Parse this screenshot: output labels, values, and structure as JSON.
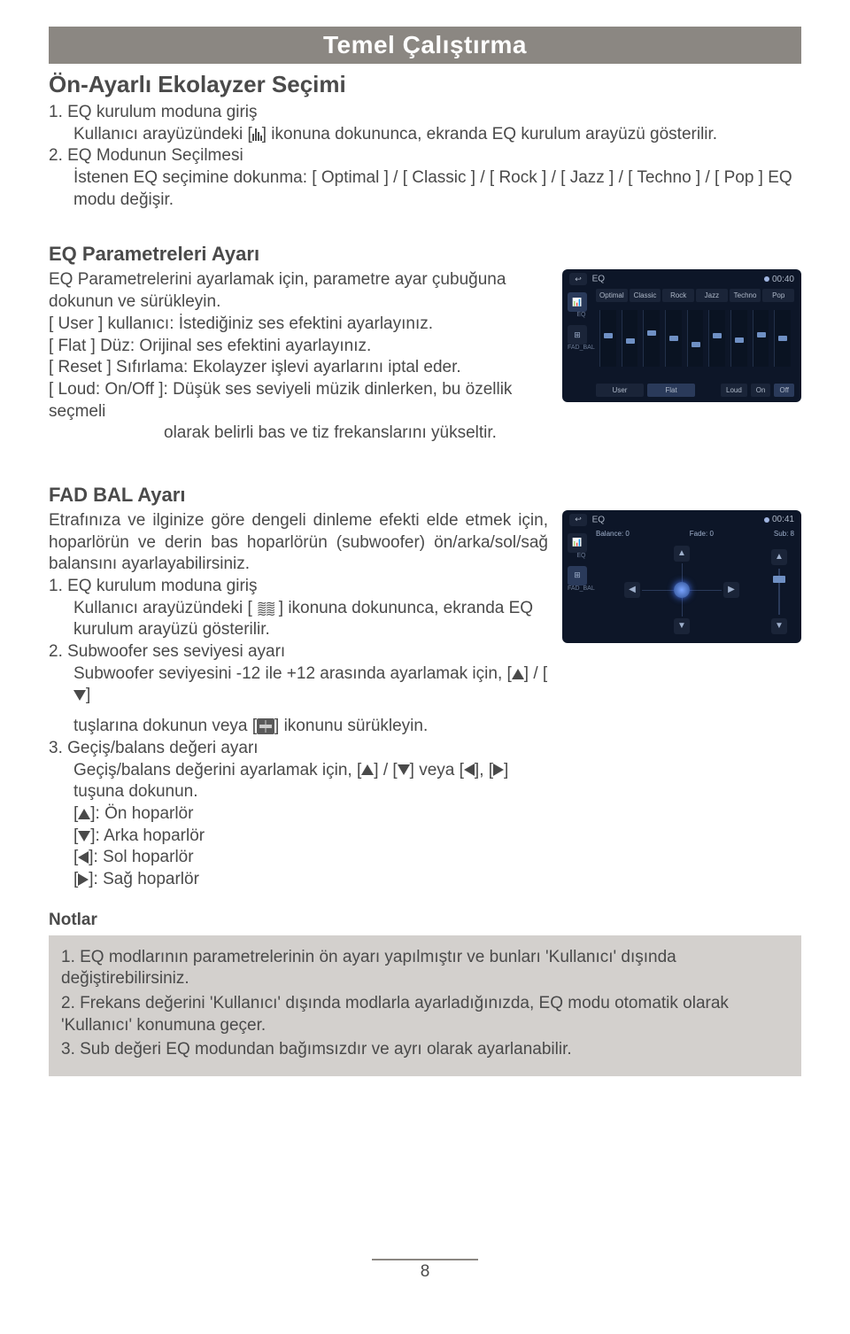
{
  "header": {
    "title": "Temel Çalıştırma"
  },
  "section1": {
    "title": "Ön-Ayarlı Ekolayzer Seçimi",
    "item1_num": "1. ",
    "item1_label": "EQ kurulum moduna giriş",
    "item1_body_a": "Kullanıcı arayüzündeki [",
    "item1_body_b": "] ikonuna dokununca, ekranda EQ kurulum arayüzü gösterilir.",
    "item2_num": "2. ",
    "item2_label": "EQ Modunun Seçilmesi",
    "item2_body": "İstenen EQ seçimine dokunma: [ Optimal ] / [ Classic ] / [ Rock ] / [ Jazz ] / [ Techno ] / [ Pop ] EQ modu değişir."
  },
  "section2": {
    "title": "EQ Parametreleri Ayarı",
    "p1": "EQ Parametrelerini ayarlamak için, parametre ayar çubuğuna dokunun ve sürükleyin.",
    "p2": "[ User ] kullanıcı: İstediğiniz ses efektini ayarlayınız.",
    "p3": "[ Flat ] Düz: Orijinal ses efektini ayarlayınız.",
    "p4": "[ Reset ] Sıfırlama: Ekolayzer işlevi ayarlarını iptal eder.",
    "p5a": "[ Loud: On/Off ]: Düşük ses seviyeli müzik dinlerken, bu özellik seçmeli",
    "p5b": "olarak belirli bas ve tiz frekanslarını yükseltir."
  },
  "shot1": {
    "title": "EQ",
    "time": "00:40",
    "tabs": [
      "Optimal",
      "Classic",
      "Rock",
      "Jazz",
      "Techno",
      "Pop"
    ],
    "side1": "EQ",
    "side2": "FAD_BAL",
    "btn_user": "User",
    "btn_flat": "Flat",
    "btn_loud": "Loud",
    "btn_on": "On",
    "btn_off": "Off"
  },
  "section3": {
    "title": "FAD BAL Ayarı",
    "p1": "Etrafınıza ve ilginize göre dengeli dinleme efekti elde etmek için, hoparlörün ve derin bas hoparlörün (subwoofer) ön/arka/sol/sağ balansını ayarlayabilirsiniz.",
    "i1_num": "1. ",
    "i1_label": "EQ kurulum moduna giriş",
    "i1_body_a": "Kullanıcı arayüzündeki [ ",
    "i1_body_b": " ] ikonuna dokununca, ekranda EQ kurulum arayüzü gösterilir.",
    "i2_num": "2. ",
    "i2_label": "Subwoofer ses seviyesi ayarı",
    "i2_body_a": "Subwoofer seviyesini -12 ile +12 arasında ayarlamak için, [",
    "i2_body_b": "] / [",
    "i2_body_c": "]",
    "i2_body_d": "tuşlarına dokunun veya [",
    "i2_body_e": "] ikonunu sürükleyin.",
    "i3_num": "3. ",
    "i3_label": "Geçiş/balans değeri ayarı",
    "i3_body_a": "Geçiş/balans değerini ayarlamak için, [",
    "i3_body_b": "] / [",
    "i3_body_c": "] veya [",
    "i3_body_d": "], [",
    "i3_body_e": "] tuşuna dokunun.",
    "d_up": "]: Ön hoparlör",
    "d_down": "]: Arka hoparlör",
    "d_left": "]: Sol hoparlör",
    "d_right": "]: Sağ hoparlör"
  },
  "shot2": {
    "title": "EQ",
    "time": "00:41",
    "balance": "Balance:  0",
    "fade": "Fade:  0",
    "sub": "Sub:  8",
    "side1": "EQ",
    "side2": "FAD_BAL"
  },
  "notes": {
    "title": "Notlar",
    "n1_num": "1. ",
    "n1": "EQ modlarının parametrelerinin ön ayarı yapılmıştır ve bunları 'Kullanıcı' dışında değiştirebilirsiniz.",
    "n2_num": "2. ",
    "n2": "Frekans değerini 'Kullanıcı' dışında modlarla ayarladığınızda, EQ modu otomatik olarak 'Kullanıcı' konumuna geçer.",
    "n3_num": "3. ",
    "n3": "Sub değeri EQ modundan bağımsızdır ve ayrı olarak ayarlanabilir."
  },
  "page_number": "8"
}
